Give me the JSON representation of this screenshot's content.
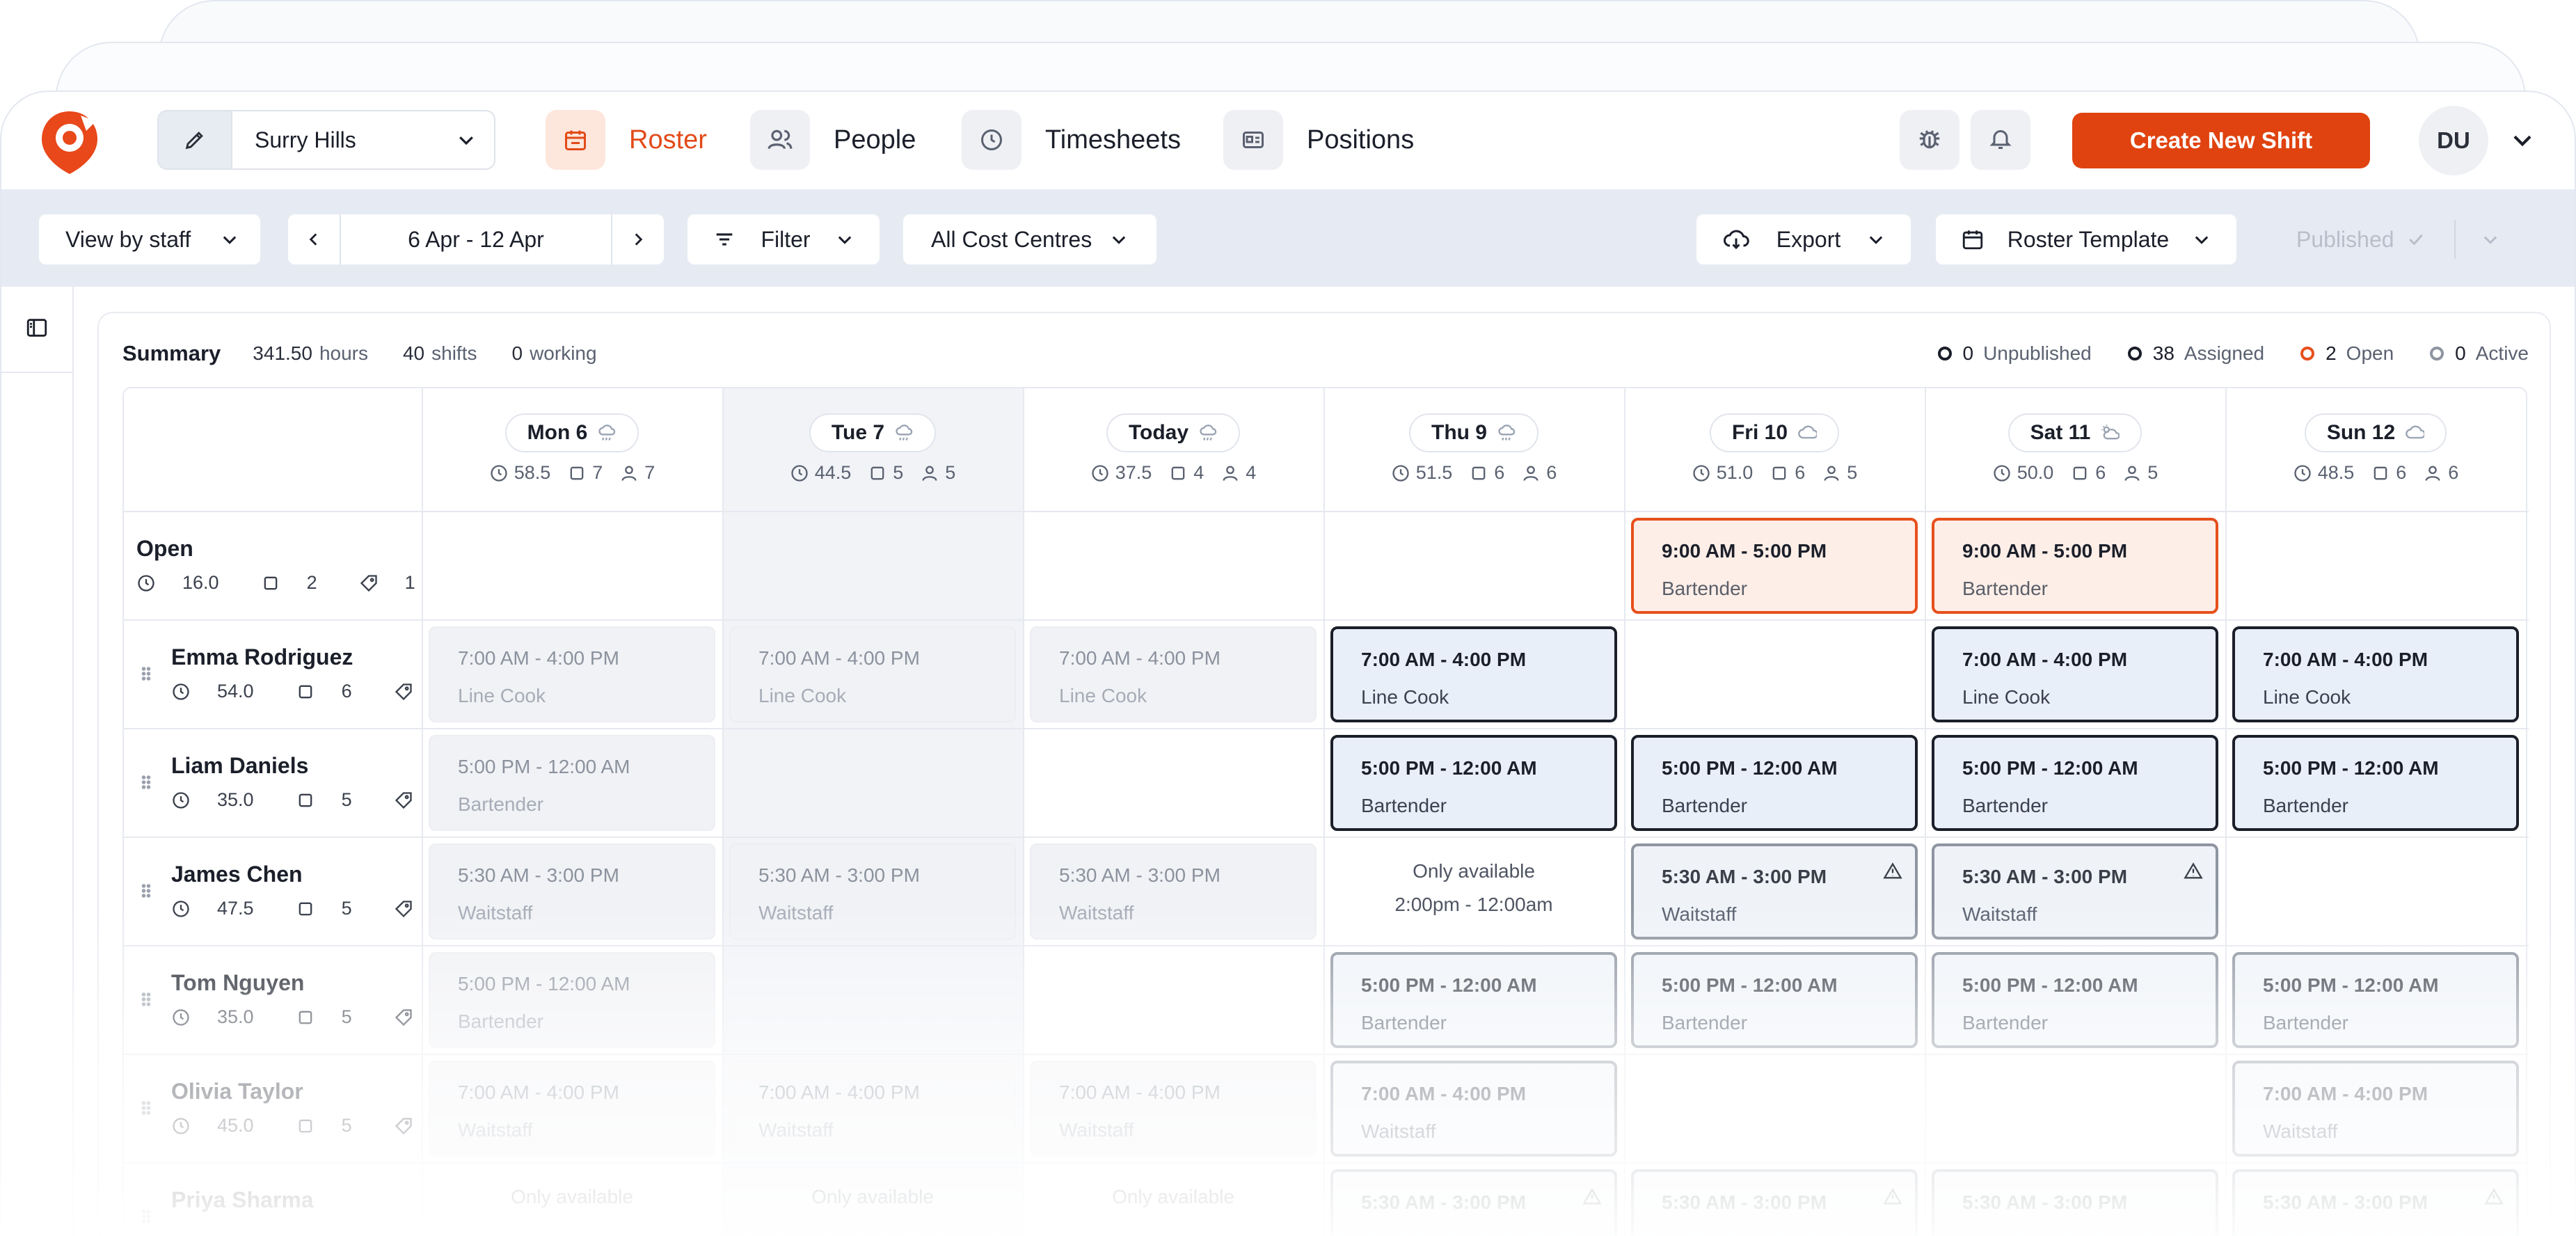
{
  "nav": {
    "location": "Surry Hills",
    "items": [
      {
        "label": "Roster",
        "icon": "calendar-icon",
        "active": true
      },
      {
        "label": "People",
        "icon": "people-icon",
        "active": false
      },
      {
        "label": "Timesheets",
        "icon": "clock-icon",
        "active": false
      },
      {
        "label": "Positions",
        "icon": "id-card-icon",
        "active": false
      }
    ],
    "create_label": "Create New Shift",
    "avatar_initials": "DU",
    "accent": "#e0430f"
  },
  "toolbar": {
    "view_label": "View by staff",
    "date_range": "6 Apr - 12 Apr",
    "filter_label": "Filter",
    "cost_centres_label": "All Cost Centres",
    "export_label": "Export",
    "template_label": "Roster Template",
    "published_label": "Published"
  },
  "summary": {
    "title": "Summary",
    "hours_value": "341.50",
    "hours_label": "hours",
    "shifts_value": "40",
    "shifts_label": "shifts",
    "working_value": "0",
    "working_label": "working"
  },
  "legend": [
    {
      "value": "0",
      "label": "Unpublished",
      "color": "#1b1f2a"
    },
    {
      "value": "38",
      "label": "Assigned",
      "color": "#1b1f2a"
    },
    {
      "value": "2",
      "label": "Open",
      "color": "#e7501c"
    },
    {
      "value": "0",
      "label": "Active",
      "color": "#8e95a1"
    }
  ],
  "days": [
    {
      "label": "Mon 6",
      "weather": "rain",
      "hours": "58.5",
      "shifts": "7",
      "people": "7"
    },
    {
      "label": "Tue 7",
      "weather": "rain",
      "hours": "44.5",
      "shifts": "5",
      "people": "5"
    },
    {
      "label": "Today",
      "weather": "rain",
      "hours": "37.5",
      "shifts": "4",
      "people": "4"
    },
    {
      "label": "Thu 9",
      "weather": "rain",
      "hours": "51.5",
      "shifts": "6",
      "people": "6"
    },
    {
      "label": "Fri 10",
      "weather": "cloud",
      "hours": "51.0",
      "shifts": "6",
      "people": "5"
    },
    {
      "label": "Sat 11",
      "weather": "partly-cloudy",
      "hours": "50.0",
      "shifts": "6",
      "people": "5"
    },
    {
      "label": "Sun 12",
      "weather": "cloud",
      "hours": "48.5",
      "shifts": "6",
      "people": "6"
    }
  ],
  "rows": [
    {
      "name": "Open",
      "hours": "16.0",
      "shifts": "2",
      "tags": "1",
      "open": true
    },
    {
      "name": "Emma Rodriguez",
      "hours": "54.0",
      "shifts": "6",
      "tags": "1"
    },
    {
      "name": "Liam Daniels",
      "hours": "35.0",
      "shifts": "5",
      "tags": "1"
    },
    {
      "name": "James Chen",
      "hours": "47.5",
      "shifts": "5",
      "tags": "1"
    },
    {
      "name": "Tom Nguyen",
      "hours": "35.0",
      "shifts": "5",
      "tags": "1"
    },
    {
      "name": "Olivia Taylor",
      "hours": "45.0",
      "shifts": "5",
      "tags": "1"
    },
    {
      "name": "Priya Sharma",
      "hours": "",
      "shifts": "",
      "tags": ""
    }
  ],
  "shifts": [
    {
      "row": 0,
      "day": 4,
      "time": "9:00 AM - 5:00 PM",
      "role": "Bartender",
      "style": "open"
    },
    {
      "row": 0,
      "day": 5,
      "time": "9:00 AM - 5:00 PM",
      "role": "Bartender",
      "style": "open"
    },
    {
      "row": 1,
      "day": 0,
      "time": "7:00 AM - 4:00 PM",
      "role": "Line Cook",
      "style": "ghosted"
    },
    {
      "row": 1,
      "day": 1,
      "time": "7:00 AM - 4:00 PM",
      "role": "Line Cook",
      "style": "ghosted"
    },
    {
      "row": 1,
      "day": 2,
      "time": "7:00 AM - 4:00 PM",
      "role": "Line Cook",
      "style": "ghosted"
    },
    {
      "row": 1,
      "day": 3,
      "time": "7:00 AM - 4:00 PM",
      "role": "Line Cook",
      "style": "assigned"
    },
    {
      "row": 1,
      "day": 5,
      "time": "7:00 AM - 4:00 PM",
      "role": "Line Cook",
      "style": "assigned"
    },
    {
      "row": 1,
      "day": 6,
      "time": "7:00 AM - 4:00 PM",
      "role": "Line Cook",
      "style": "assigned"
    },
    {
      "row": 2,
      "day": 0,
      "time": "5:00 PM - 12:00 AM",
      "role": "Bartender",
      "style": "ghosted"
    },
    {
      "row": 2,
      "day": 3,
      "time": "5:00 PM - 12:00 AM",
      "role": "Bartender",
      "style": "assigned"
    },
    {
      "row": 2,
      "day": 4,
      "time": "5:00 PM - 12:00 AM",
      "role": "Bartender",
      "style": "assigned"
    },
    {
      "row": 2,
      "day": 5,
      "time": "5:00 PM - 12:00 AM",
      "role": "Bartender",
      "style": "assigned"
    },
    {
      "row": 2,
      "day": 6,
      "time": "5:00 PM - 12:00 AM",
      "role": "Bartender",
      "style": "assigned"
    },
    {
      "row": 3,
      "day": 0,
      "time": "5:30 AM - 3:00 PM",
      "role": "Waitstaff",
      "style": "ghosted"
    },
    {
      "row": 3,
      "day": 1,
      "time": "5:30 AM - 3:00 PM",
      "role": "Waitstaff",
      "style": "ghosted"
    },
    {
      "row": 3,
      "day": 2,
      "time": "5:30 AM - 3:00 PM",
      "role": "Waitstaff",
      "style": "ghosted"
    },
    {
      "row": 3,
      "day": 4,
      "time": "5:30 AM - 3:00 PM",
      "role": "Waitstaff",
      "style": "soft",
      "warning": true
    },
    {
      "row": 3,
      "day": 5,
      "time": "5:30 AM - 3:00 PM",
      "role": "Waitstaff",
      "style": "soft",
      "warning": true
    },
    {
      "row": 4,
      "day": 0,
      "time": "5:00 PM - 12:00 AM",
      "role": "Bartender",
      "style": "ghosted"
    },
    {
      "row": 4,
      "day": 3,
      "time": "5:00 PM - 12:00 AM",
      "role": "Bartender",
      "style": "soft"
    },
    {
      "row": 4,
      "day": 4,
      "time": "5:00 PM - 12:00 AM",
      "role": "Bartender",
      "style": "soft"
    },
    {
      "row": 4,
      "day": 5,
      "time": "5:00 PM - 12:00 AM",
      "role": "Bartender",
      "style": "soft"
    },
    {
      "row": 4,
      "day": 6,
      "time": "5:00 PM - 12:00 AM",
      "role": "Bartender",
      "style": "soft"
    },
    {
      "row": 5,
      "day": 0,
      "time": "7:00 AM - 4:00 PM",
      "role": "Waitstaff",
      "style": "ghosted"
    },
    {
      "row": 5,
      "day": 1,
      "time": "7:00 AM - 4:00 PM",
      "role": "Waitstaff",
      "style": "ghosted"
    },
    {
      "row": 5,
      "day": 2,
      "time": "7:00 AM - 4:00 PM",
      "role": "Waitstaff",
      "style": "ghosted"
    },
    {
      "row": 5,
      "day": 3,
      "time": "7:00 AM - 4:00 PM",
      "role": "Waitstaff",
      "style": "soft"
    },
    {
      "row": 5,
      "day": 6,
      "time": "7:00 AM - 4:00 PM",
      "role": "Waitstaff",
      "style": "soft"
    },
    {
      "row": 6,
      "day": 3,
      "time": "5:30 AM - 3:00 PM",
      "role": "",
      "style": "soft",
      "warning": true
    },
    {
      "row": 6,
      "day": 4,
      "time": "5:30 AM - 3:00 PM",
      "role": "",
      "style": "soft",
      "warning": true
    },
    {
      "row": 6,
      "day": 5,
      "time": "5:30 AM - 3:00 PM",
      "role": "",
      "style": "soft"
    },
    {
      "row": 6,
      "day": 6,
      "time": "5:30 AM - 3:00 PM",
      "role": "",
      "style": "soft",
      "warning": true
    }
  ],
  "availability": [
    {
      "row": 3,
      "day": 3,
      "lines": [
        "Only available",
        "2:00pm - 12:00am"
      ]
    },
    {
      "row": 6,
      "day": 0,
      "lines": [
        "Only available"
      ]
    },
    {
      "row": 6,
      "day": 1,
      "lines": [
        "Only available"
      ]
    },
    {
      "row": 6,
      "day": 2,
      "lines": [
        "Only available"
      ]
    }
  ]
}
